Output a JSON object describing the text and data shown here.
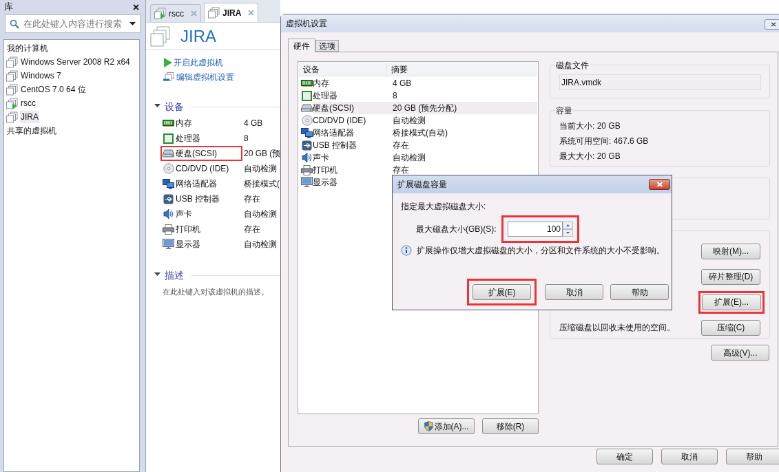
{
  "library": {
    "title": "库",
    "search": {
      "placeholder": "在此处键入内容进行搜索"
    },
    "tree": [
      {
        "kind": "heading",
        "label": "我的计算机",
        "selected": false
      },
      {
        "kind": "vm",
        "label": "Windows Server 2008 R2 x64",
        "running": false,
        "selected": false
      },
      {
        "kind": "vm",
        "label": "Windows 7",
        "running": false,
        "selected": false
      },
      {
        "kind": "vm",
        "label": "CentOS 7.0 64 位",
        "running": false,
        "selected": false
      },
      {
        "kind": "vm",
        "label": "rscc",
        "running": true,
        "selected": false
      },
      {
        "kind": "vm",
        "label": "JIRA",
        "running": false,
        "selected": true
      },
      {
        "kind": "heading",
        "label": "共享的虚拟机",
        "selected": false
      }
    ]
  },
  "vm_panel": {
    "tabs": [
      {
        "label": "rscc",
        "running": true,
        "selected": false
      },
      {
        "label": "JIRA",
        "running": false,
        "selected": true
      }
    ],
    "title": "JIRA",
    "actions": [
      {
        "kind": "power",
        "label": "开启此虚拟机"
      },
      {
        "kind": "edit",
        "label": "编辑虚拟机设置"
      }
    ],
    "devices": {
      "title": "设备",
      "expanded": true,
      "items": [
        {
          "kind": "memory",
          "name": "内存",
          "value": "4 GB",
          "highlighted": false
        },
        {
          "kind": "cpu",
          "name": "处理器",
          "value": "8",
          "highlighted": false
        },
        {
          "kind": "disk",
          "name": "硬盘(SCSI)",
          "value": "20 GB (预",
          "highlighted": true
        },
        {
          "kind": "cdrom",
          "name": "CD/DVD (IDE)",
          "value": "自动检测",
          "highlighted": false
        },
        {
          "kind": "network",
          "name": "网络适配器",
          "value": "桥接模式(",
          "highlighted": false
        },
        {
          "kind": "usb",
          "name": "USB 控制器",
          "value": "存在",
          "highlighted": false
        },
        {
          "kind": "sound",
          "name": "声卡",
          "value": "自动检测",
          "highlighted": false
        },
        {
          "kind": "printer",
          "name": "打印机",
          "value": "存在",
          "highlighted": false
        },
        {
          "kind": "display",
          "name": "显示器",
          "value": "自动检测",
          "highlighted": false
        }
      ]
    },
    "description": {
      "title": "描述",
      "expanded": true,
      "placeholder": "在此处键入对该虚拟机的描述。"
    }
  },
  "settings_dialog": {
    "title": "虚拟机设置",
    "tabs": [
      {
        "label": "硬件",
        "selected": true
      },
      {
        "label": "选项",
        "selected": false
      }
    ],
    "device_table": {
      "columns": [
        "设备",
        "摘要"
      ],
      "rows": [
        {
          "kind": "memory",
          "device": "内存",
          "summary": "4 GB",
          "selected": false
        },
        {
          "kind": "cpu",
          "device": "处理器",
          "summary": "8",
          "selected": false
        },
        {
          "kind": "disk",
          "device": "硬盘(SCSI)",
          "summary": "20 GB (预先分配)",
          "selected": true
        },
        {
          "kind": "cdrom",
          "device": "CD/DVD (IDE)",
          "summary": "自动检测",
          "selected": false
        },
        {
          "kind": "network",
          "device": "网络适配器",
          "summary": "桥接模式(自动)",
          "selected": false
        },
        {
          "kind": "usb",
          "device": "USB 控制器",
          "summary": "存在",
          "selected": false
        },
        {
          "kind": "sound",
          "device": "声卡",
          "summary": "自动检测",
          "selected": false
        },
        {
          "kind": "printer",
          "device": "打印机",
          "summary": "存在",
          "selected": false
        },
        {
          "kind": "display",
          "device": "显示器",
          "summary": "",
          "selected": false
        }
      ]
    },
    "list_buttons": [
      {
        "kind": "shield",
        "label": "添加(A)..."
      },
      {
        "kind": "plain",
        "label": "移除(R)"
      }
    ],
    "disk_file": {
      "label": "磁盘文件",
      "value": "JIRA.vmdk"
    },
    "capacity": {
      "label": "容量",
      "lines": [
        "当前大小: 20 GB",
        "系统可用空间: 467.6 GB",
        "最大大小: 20 GB"
      ]
    },
    "utilities": [
      {
        "button": "映射(M)...",
        "highlighted": false
      },
      {
        "button": "碎片整理(D)",
        "highlighted": false
      },
      {
        "button": "扩展(E)...",
        "highlighted": true
      },
      {
        "description": "压缩磁盘以回收未使用的空间。",
        "button": "压缩(C)",
        "highlighted": false
      }
    ],
    "advanced_button": "高级(V)...",
    "footer_buttons": [
      "确定",
      "取消",
      "帮助"
    ]
  },
  "expand_dialog": {
    "title": "扩展磁盘容量",
    "prompt": "指定最大虚拟磁盘大小:",
    "size_label": "最大磁盘大小(GB)(S):",
    "size_value": "100",
    "size_highlighted": true,
    "note": "扩展操作仅增大虚拟磁盘的大小，分区和文件系统的大小不受影响。",
    "buttons": [
      {
        "label": "扩展(E)",
        "highlighted": true
      },
      {
        "label": "取消",
        "highlighted": false
      },
      {
        "label": "帮助",
        "highlighted": false
      }
    ]
  }
}
